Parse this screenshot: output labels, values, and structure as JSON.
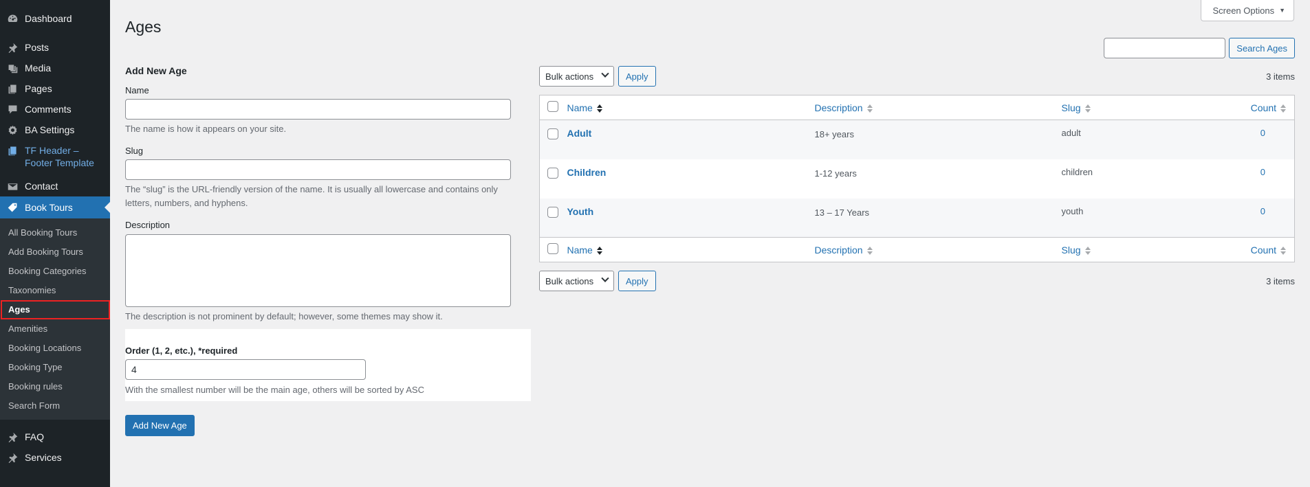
{
  "sidebar": {
    "items": [
      {
        "label": "Dashboard",
        "icon": "dashboard-icon"
      },
      {
        "label": "Posts",
        "icon": "pin-icon"
      },
      {
        "label": "Media",
        "icon": "media-icon"
      },
      {
        "label": "Pages",
        "icon": "pages-icon"
      },
      {
        "label": "Comments",
        "icon": "comment-icon"
      },
      {
        "label": "BA Settings",
        "icon": "gear-icon"
      },
      {
        "label": "TF Header – Footer Template",
        "icon": "pages-icon"
      },
      {
        "label": "Contact",
        "icon": "mail-icon"
      },
      {
        "label": "Book Tours",
        "icon": "tag-icon"
      },
      {
        "label": "FAQ",
        "icon": "pin-icon"
      },
      {
        "label": "Services",
        "icon": "pin-icon"
      }
    ],
    "submenu": [
      "All Booking Tours",
      "Add Booking Tours",
      "Booking Categories",
      "Taxonomies",
      "Ages",
      "Amenities",
      "Booking Locations",
      "Booking Type",
      "Booking rules",
      "Search Form"
    ]
  },
  "header": {
    "title": "Ages",
    "screen_options": "Screen Options",
    "search_button": "Search Ages",
    "search_value": ""
  },
  "form": {
    "heading": "Add New Age",
    "name_label": "Name",
    "name_hint": "The name is how it appears on your site.",
    "slug_label": "Slug",
    "slug_hint": "The “slug” is the URL-friendly version of the name. It is usually all lowercase and contains only letters, numbers, and hyphens.",
    "description_label": "Description",
    "description_hint": "The description is not prominent by default; however, some themes may show it.",
    "order_label": "Order (1, 2, etc.), *required",
    "order_value": "4",
    "order_hint": "With the smallest number will be the main age, others will be sorted by ASC",
    "submit": "Add New Age"
  },
  "list": {
    "bulk_actions": "Bulk actions",
    "apply": "Apply",
    "items_count": "3 items",
    "columns": {
      "name": "Name",
      "description": "Description",
      "slug": "Slug",
      "count": "Count"
    },
    "rows": [
      {
        "name": "Adult",
        "description": "18+ years",
        "slug": "adult",
        "count": "0"
      },
      {
        "name": "Children",
        "description": "1-12 years",
        "slug": "children",
        "count": "0"
      },
      {
        "name": "Youth",
        "description": "13 – 17 Years",
        "slug": "youth",
        "count": "0"
      }
    ]
  },
  "colors": {
    "sidebar_bg": "#1d2327",
    "accent": "#2271b1",
    "active_highlight": "#e22222"
  }
}
